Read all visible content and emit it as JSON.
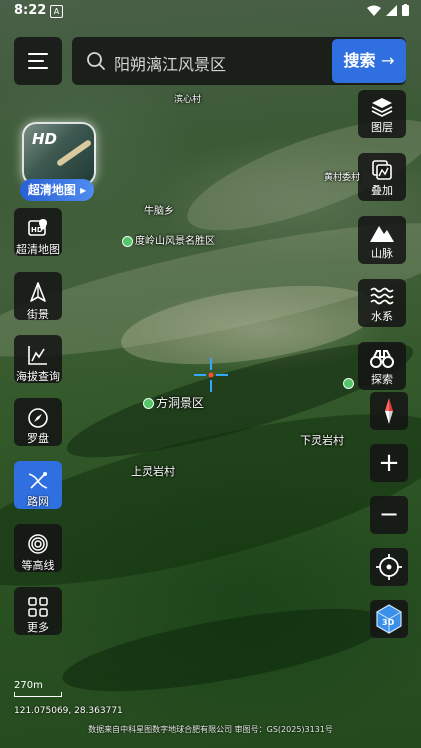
{
  "status": {
    "time": "8:22",
    "notif_letter": "A"
  },
  "search": {
    "placeholder": "阳朔漓江风景区",
    "button": "搜索"
  },
  "hd_card": {
    "badge": "HD",
    "label": "超清地图 ▸"
  },
  "left_tools": [
    {
      "label": "超清地图",
      "icon": "hd-map-icon"
    },
    {
      "label": "街景",
      "icon": "street-view-icon"
    },
    {
      "label": "海拔查询",
      "icon": "elevation-icon"
    },
    {
      "label": "罗盘",
      "icon": "compass-icon"
    },
    {
      "label": "路网",
      "icon": "road-network-icon",
      "active": true
    },
    {
      "label": "等高线",
      "icon": "contour-icon"
    },
    {
      "label": "更多",
      "icon": "more-grid-icon"
    }
  ],
  "right_tools": [
    {
      "label": "图层",
      "icon": "layers-icon"
    },
    {
      "label": "叠加",
      "icon": "overlay-icon"
    },
    {
      "label": "山脉",
      "icon": "mountain-icon"
    },
    {
      "label": "水系",
      "icon": "water-icon"
    },
    {
      "label": "探索",
      "icon": "binoculars-icon"
    }
  ],
  "map_labels": {
    "village_top": "滨心村",
    "village_right": "黄村委村",
    "town": "牛脑乡",
    "scenic_area": "度岭山风景名胜区",
    "fangdong": "方洞景区",
    "xialing": "下灵岩村",
    "shangling": "上灵岩村"
  },
  "scale": "270m",
  "coords": "121.075069, 28.363771",
  "credit": "数据来自中科星图数字地球合肥有限公司 审图号：GS(2025)3131号",
  "map_controls": {
    "zoom_in": "+",
    "zoom_out": "−",
    "mode_3d": "3D"
  },
  "colors": {
    "accent": "#2f6fe0",
    "panel": "#141414",
    "poi_green": "#55c46a"
  }
}
